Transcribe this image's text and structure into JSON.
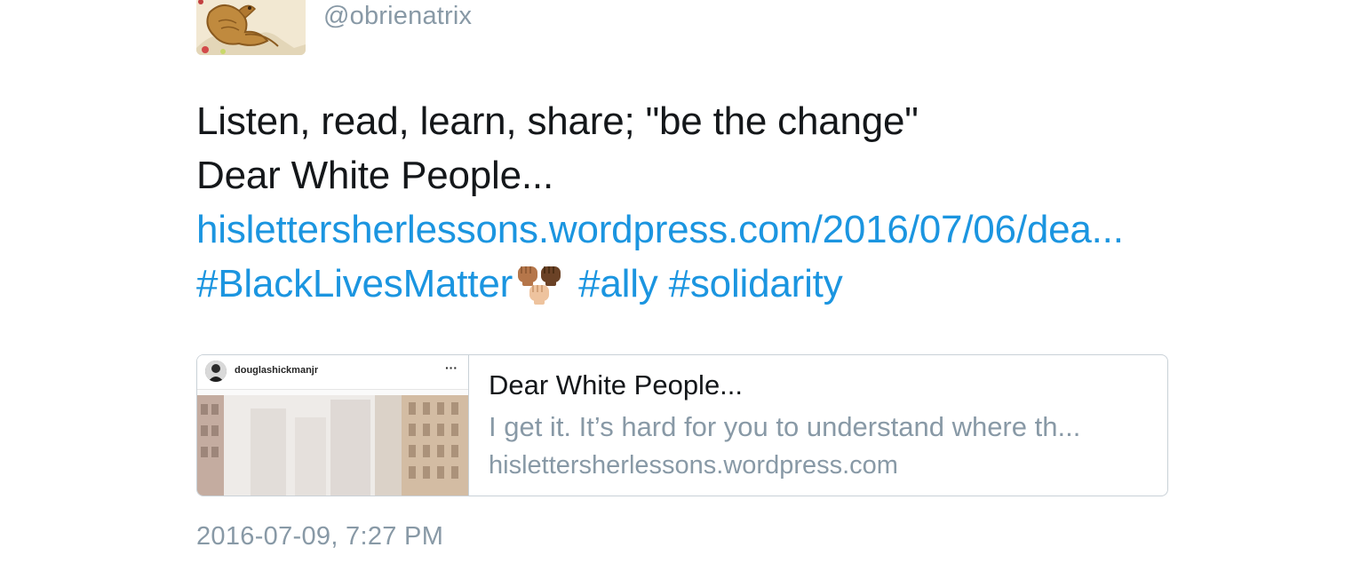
{
  "author": {
    "handle": "@obrienatrix",
    "avatar_icon": "illustrated-creature-avatar"
  },
  "tweet": {
    "line1": "Listen, read, learn, share; \"be the change\"",
    "line2": "Dear White People...",
    "link_text": "hislettersherlessons.wordpress.com/2016/07/06/dea...",
    "hashtags": [
      "#BlackLivesMatter",
      "#ally",
      "#solidarity"
    ],
    "emoji_icon": "raised-fists-emoji"
  },
  "card": {
    "thumb_username": "douglashickmanjr",
    "thumb_more": "···",
    "title": "Dear White People...",
    "description": "I get it. It’s hard for you to understand where th...",
    "domain": "hislettersherlessons.wordpress.com"
  },
  "timestamp": "2016-07-09, 7:27 PM",
  "colors": {
    "link": "#1b95e0",
    "text": "#14171a",
    "muted": "#8899a6",
    "border": "#c9d1d7"
  }
}
